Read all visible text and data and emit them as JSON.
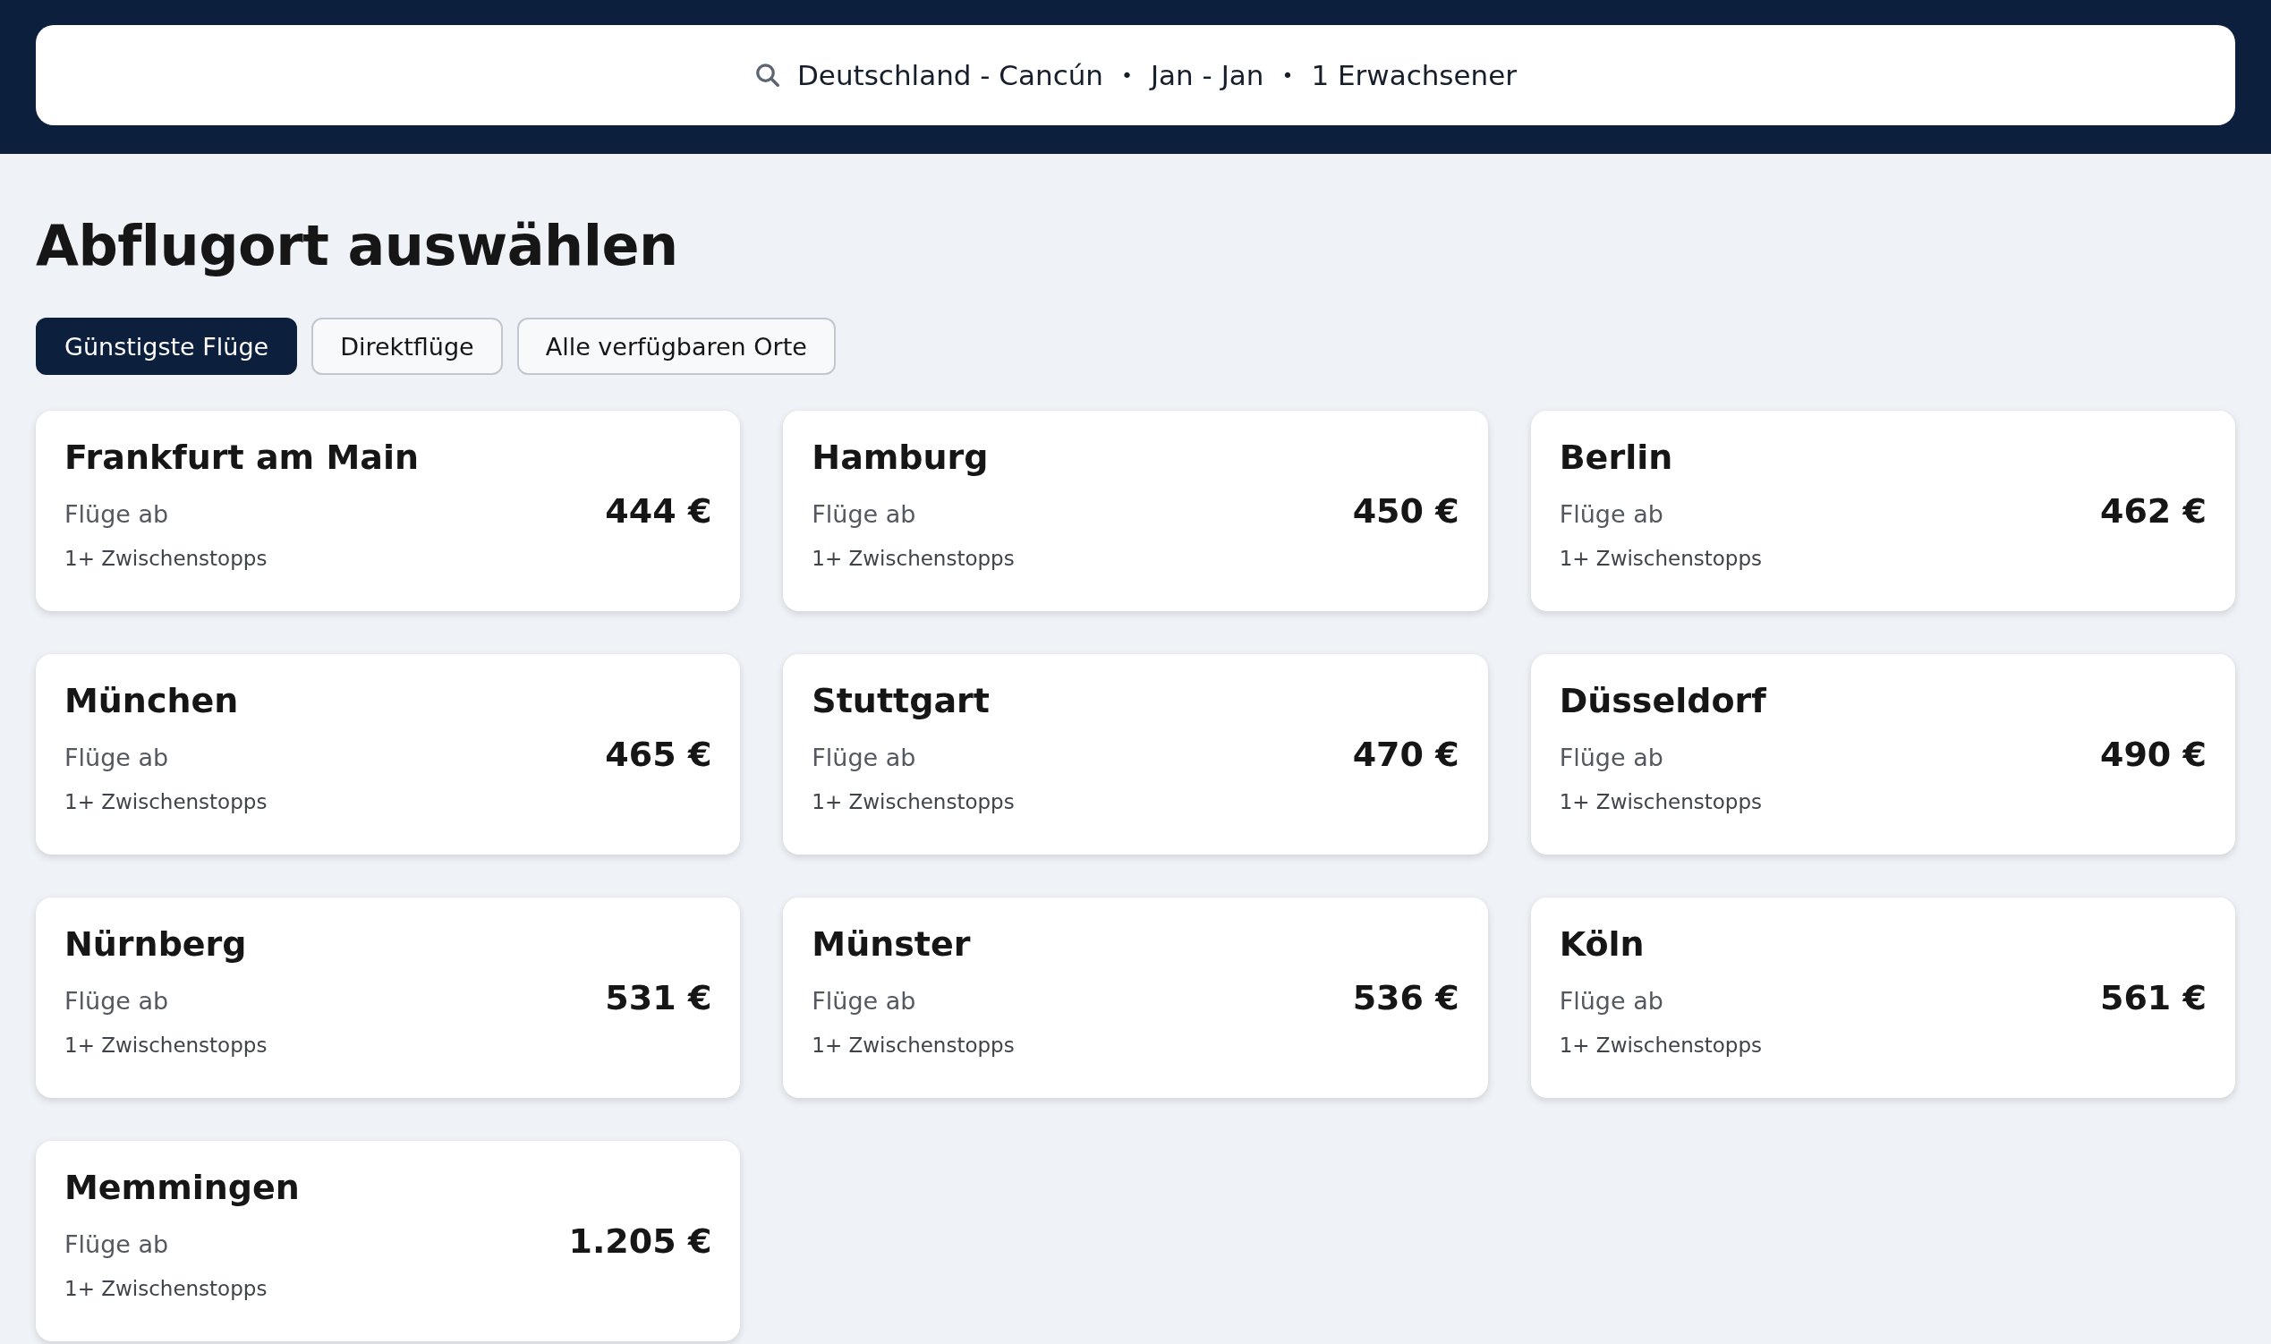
{
  "search": {
    "route": "Deutschland - Cancún",
    "dates": "Jan - Jan",
    "travellers": "1 Erwachsener",
    "separator": "•"
  },
  "title": "Abflugort auswählen",
  "filters": [
    {
      "label": "Günstigste Flüge",
      "selected": true
    },
    {
      "label": "Direktflüge",
      "selected": false
    },
    {
      "label": "Alle verfügbaren Orte",
      "selected": false
    }
  ],
  "cards": [
    {
      "city": "Frankfurt am Main",
      "label": "Flüge ab",
      "price": "444 €",
      "stops": "1+ Zwischenstopps"
    },
    {
      "city": "Hamburg",
      "label": "Flüge ab",
      "price": "450 €",
      "stops": "1+ Zwischenstopps"
    },
    {
      "city": "Berlin",
      "label": "Flüge ab",
      "price": "462 €",
      "stops": "1+ Zwischenstopps"
    },
    {
      "city": "München",
      "label": "Flüge ab",
      "price": "465 €",
      "stops": "1+ Zwischenstopps"
    },
    {
      "city": "Stuttgart",
      "label": "Flüge ab",
      "price": "470 €",
      "stops": "1+ Zwischenstopps"
    },
    {
      "city": "Düsseldorf",
      "label": "Flüge ab",
      "price": "490 €",
      "stops": "1+ Zwischenstopps"
    },
    {
      "city": "Nürnberg",
      "label": "Flüge ab",
      "price": "531 €",
      "stops": "1+ Zwischenstopps"
    },
    {
      "city": "Münster",
      "label": "Flüge ab",
      "price": "536 €",
      "stops": "1+ Zwischenstopps"
    },
    {
      "city": "Köln",
      "label": "Flüge ab",
      "price": "561 €",
      "stops": "1+ Zwischenstopps"
    },
    {
      "city": "Memmingen",
      "label": "Flüge ab",
      "price": "1.205 €",
      "stops": "1+ Zwischenstopps"
    }
  ]
}
